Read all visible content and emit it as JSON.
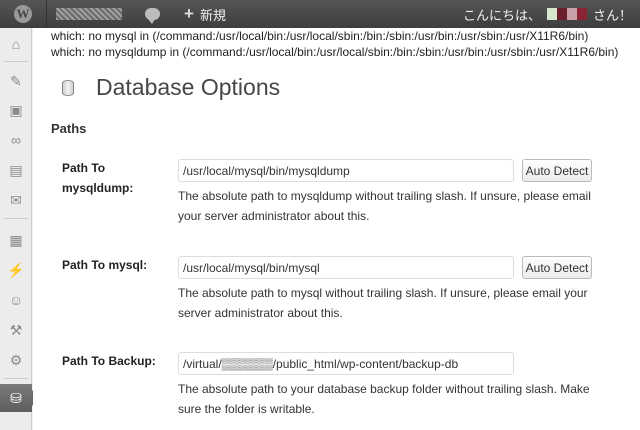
{
  "adminbar": {
    "new_label": "新規",
    "howdy_prefix": "こんにちは、",
    "howdy_suffix": "さん！",
    "avatar_colors": [
      "#d8e8d0",
      "#6b1f2d",
      "#c9a0a8",
      "#8a2435"
    ]
  },
  "sidebar": {
    "items": [
      {
        "icon": "dashboard-icon",
        "glyph": "⌂"
      },
      {
        "icon": "posts-icon",
        "glyph": "✎"
      },
      {
        "icon": "media-icon",
        "glyph": "▣"
      },
      {
        "icon": "links-icon",
        "glyph": "∞"
      },
      {
        "icon": "pages-icon",
        "glyph": "▤"
      },
      {
        "icon": "comments-icon",
        "glyph": "✉"
      },
      {
        "icon": "appearance-icon",
        "glyph": "▦"
      },
      {
        "icon": "plugins-icon",
        "glyph": "⚡"
      },
      {
        "icon": "users-icon",
        "glyph": "☺"
      },
      {
        "icon": "tools-icon",
        "glyph": "⚒"
      },
      {
        "icon": "settings-icon",
        "glyph": "⚙"
      },
      {
        "icon": "database-icon",
        "glyph": "⛁"
      }
    ]
  },
  "warnings": {
    "line1": "which: no mysql in (/command:/usr/local/bin:/usr/local/sbin:/bin:/sbin:/usr/bin:/usr/sbin:/usr/X11R6/bin)",
    "line2": "which: no mysqldump in (/command:/usr/local/bin:/usr/local/sbin:/bin:/sbin:/usr/bin:/usr/sbin:/usr/X11R6/bin)"
  },
  "page": {
    "title": "Database Options",
    "section": "Paths"
  },
  "options": {
    "mysqldump": {
      "label_line1": "Path To",
      "label_line2": "mysqldump:",
      "value": "/usr/local/mysql/bin/mysqldump",
      "button": "Auto Detect",
      "desc_line1": "The absolute path to mysqldump without trailing slash. If unsure, please email",
      "desc_line2": "your server administrator about this."
    },
    "mysql": {
      "label": "Path To mysql:",
      "value": "/usr/local/mysql/bin/mysql",
      "button": "Auto Detect",
      "desc_line1": "The absolute path to mysql without trailing slash. If unsure, please email your",
      "desc_line2": "server administrator about this."
    },
    "backup": {
      "label": "Path To Backup:",
      "value": "/virtual/▒▒▒▒▒▒/public_html/wp-content/backup-db",
      "desc_line1": "The absolute path to your database backup folder without trailing slash. Make",
      "desc_line2": "sure the folder is writable."
    }
  }
}
